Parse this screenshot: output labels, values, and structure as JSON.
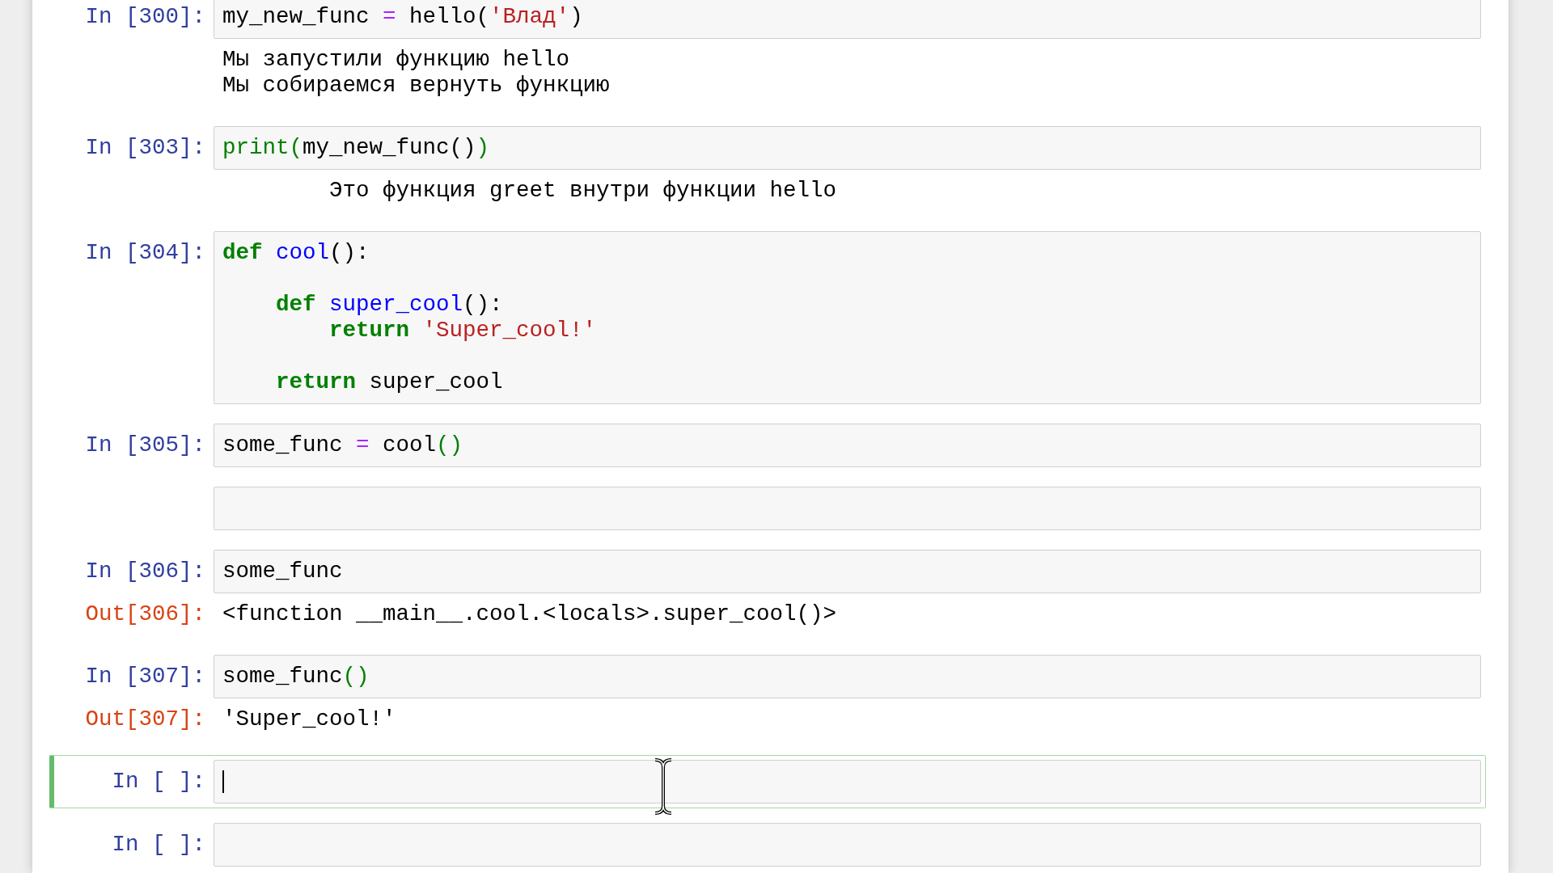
{
  "cells": [
    {
      "kind": "code",
      "prompt": "In [300]:",
      "selected": false,
      "lines": [
        [
          {
            "text": "my_new_func ",
            "kind": "plain"
          },
          {
            "text": "=",
            "kind": "operator"
          },
          {
            "text": " hello(",
            "kind": "plain"
          },
          {
            "text": "'Влад'",
            "kind": "string"
          },
          {
            "text": ")",
            "kind": "plain"
          }
        ]
      ],
      "outputs": [
        {
          "kind": "stream",
          "lines": [
            "Мы запустили функцию hello",
            "Мы собираемся вернуть функцию"
          ]
        }
      ]
    },
    {
      "kind": "code",
      "prompt": "In [303]:",
      "selected": false,
      "lines": [
        [
          {
            "text": "print(",
            "kind": "builtin"
          },
          {
            "text": "my_new_func()",
            "kind": "plain"
          },
          {
            "text": ")",
            "kind": "builtin"
          }
        ]
      ],
      "outputs": [
        {
          "kind": "stream",
          "lines": [
            "        Это функция greet внутри функции hello"
          ]
        }
      ]
    },
    {
      "kind": "code",
      "prompt": "In [304]:",
      "selected": false,
      "lines": [
        [
          {
            "text": "def",
            "kind": "keyword"
          },
          {
            "text": " cool",
            "kind": "defname"
          },
          {
            "text": "():",
            "kind": "plain"
          }
        ]
      ],
      "block": [
        {
          "blank_before": true,
          "tokens": [
            {
              "text": "def",
              "kind": "keyword"
            },
            {
              "text": " super_cool",
              "kind": "defname"
            },
            {
              "text": "():",
              "kind": "plain"
            }
          ],
          "children": [
            {
              "blank_before": false,
              "tokens": [
                {
                  "text": "return",
                  "kind": "keyword"
                },
                {
                  "text": " 'Super_cool!'",
                  "kind": "string"
                }
              ]
            }
          ]
        },
        {
          "blank_before": true,
          "tokens": [
            {
              "text": "return",
              "kind": "keyword"
            },
            {
              "text": " super_cool",
              "kind": "plain"
            }
          ]
        }
      ]
    },
    {
      "kind": "code",
      "prompt": "In [305]:",
      "selected": false,
      "lines": [
        [
          {
            "text": "some_func ",
            "kind": "plain"
          },
          {
            "text": "=",
            "kind": "operator"
          },
          {
            "text": " cool",
            "kind": "plain"
          },
          {
            "text": "()",
            "kind": "builtin"
          }
        ]
      ]
    },
    {
      "kind": "blank",
      "selected": false
    },
    {
      "kind": "code",
      "prompt": "In [306]:",
      "selected": false,
      "lines": [
        [
          {
            "text": "some_func",
            "kind": "plain"
          }
        ]
      ],
      "outputs": [
        {
          "kind": "result",
          "prompt": "Out[306]:",
          "lines": [
            "<function __main__.cool.<locals>.super_cool()>"
          ]
        }
      ]
    },
    {
      "kind": "code",
      "prompt": "In [307]:",
      "selected": false,
      "lines": [
        [
          {
            "text": "some_func",
            "kind": "plain"
          },
          {
            "text": "()",
            "kind": "builtin"
          }
        ]
      ],
      "outputs": [
        {
          "kind": "result",
          "prompt": "Out[307]:",
          "lines": [
            "'Super_cool!'"
          ]
        }
      ]
    },
    {
      "kind": "code",
      "prompt": "In [ ]:",
      "selected": true
    },
    {
      "kind": "code",
      "prompt": "In [ ]:",
      "selected": false
    }
  ]
}
